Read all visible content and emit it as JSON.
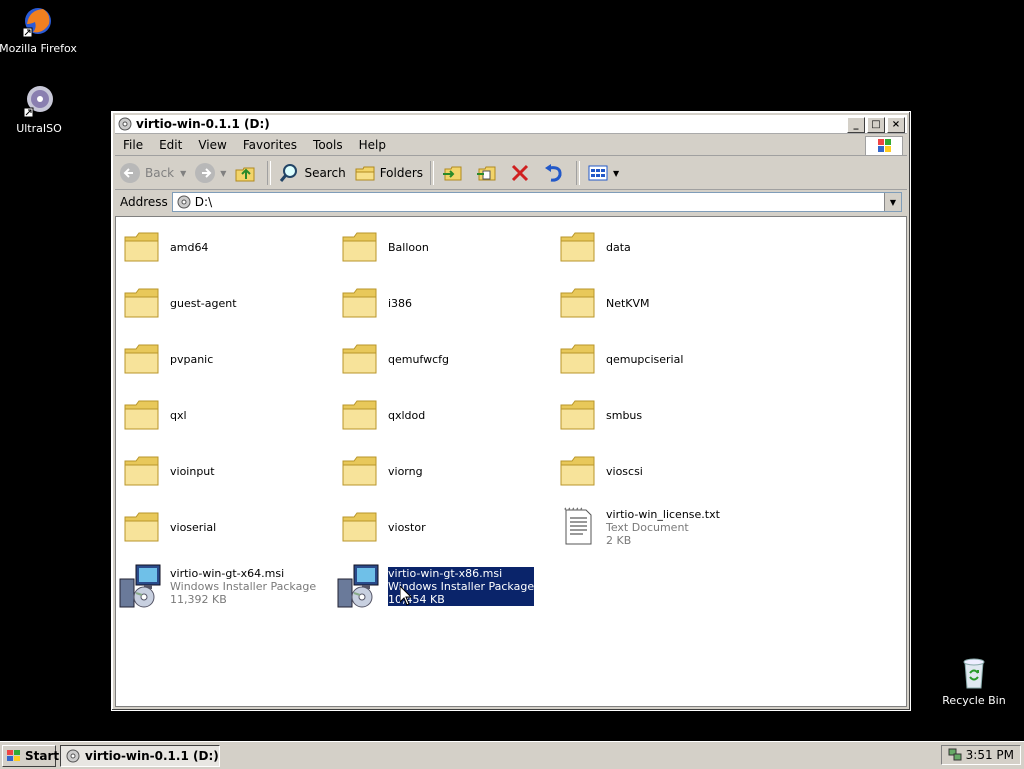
{
  "desktop": {
    "icons": [
      {
        "label": "Mozilla Firefox",
        "icon": "firefox-icon"
      },
      {
        "label": "UltraISO",
        "icon": "ultraiso-icon"
      },
      {
        "label": "Recycle Bin",
        "icon": "recycle-bin-icon"
      }
    ]
  },
  "window": {
    "title": "virtio-win-0.1.1 (D:)",
    "controls": {
      "minimize": "_",
      "maximize": "□",
      "close": "×"
    },
    "menu": [
      "File",
      "Edit",
      "View",
      "Favorites",
      "Tools",
      "Help"
    ],
    "toolbar": {
      "back": "Back",
      "search": "Search",
      "folders": "Folders"
    },
    "address": {
      "label": "Address",
      "value": "D:\\"
    }
  },
  "items": [
    {
      "name": "amd64",
      "type": "folder"
    },
    {
      "name": "Balloon",
      "type": "folder"
    },
    {
      "name": "data",
      "type": "folder"
    },
    {
      "name": "guest-agent",
      "type": "folder"
    },
    {
      "name": "i386",
      "type": "folder"
    },
    {
      "name": "NetKVM",
      "type": "folder"
    },
    {
      "name": "pvpanic",
      "type": "folder"
    },
    {
      "name": "qemufwcfg",
      "type": "folder"
    },
    {
      "name": "qemupciserial",
      "type": "folder"
    },
    {
      "name": "qxl",
      "type": "folder"
    },
    {
      "name": "qxldod",
      "type": "folder"
    },
    {
      "name": "smbus",
      "type": "folder"
    },
    {
      "name": "vioinput",
      "type": "folder"
    },
    {
      "name": "viorng",
      "type": "folder"
    },
    {
      "name": "vioscsi",
      "type": "folder"
    },
    {
      "name": "vioserial",
      "type": "folder"
    },
    {
      "name": "viostor",
      "type": "folder"
    },
    {
      "name": "virtio-win_license.txt",
      "type": "text",
      "desc": "Text Document",
      "size": "2 KB"
    },
    {
      "name": "virtio-win-gt-x64.msi",
      "type": "msi",
      "desc": "Windows Installer Package",
      "size": "11,392 KB"
    },
    {
      "name": "virtio-win-gt-x86.msi",
      "type": "msi",
      "desc": "Windows Installer Package",
      "size": "10,454 KB",
      "selected": true
    }
  ],
  "taskbar": {
    "start": "Start",
    "task": "virtio-win-0.1.1 (D:)",
    "clock": "3:51 PM"
  },
  "colors": {
    "selection": "#0a246a",
    "desktop": "#000000",
    "chrome": "#d4d0c8"
  }
}
